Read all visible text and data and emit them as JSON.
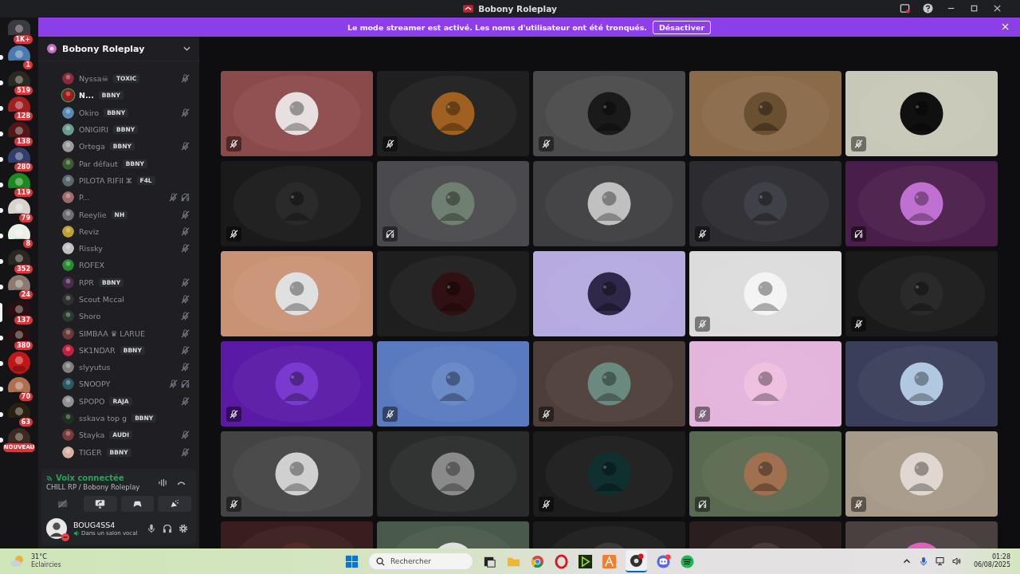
{
  "window": {
    "title": "Bobony Roleplay"
  },
  "banner": {
    "text": "Le mode streamer est activé. Les noms d'utilisateur ont été tronqués.",
    "button": "Désactiver"
  },
  "servers": [
    {
      "badge": "1K+",
      "selected": false,
      "unread": false
    },
    {
      "badge": "1",
      "selected": false,
      "unread": true
    },
    {
      "badge": "519",
      "selected": false,
      "unread": true
    },
    {
      "badge": "128",
      "selected": false,
      "unread": true
    },
    {
      "badge": "138",
      "selected": false,
      "unread": true
    },
    {
      "badge": "280",
      "selected": false,
      "unread": true
    },
    {
      "badge": "119",
      "selected": false,
      "unread": true
    },
    {
      "badge": "79",
      "selected": false,
      "unread": true
    },
    {
      "badge": "8",
      "selected": false,
      "unread": true
    },
    {
      "badge": "352",
      "selected": false,
      "unread": true
    },
    {
      "badge": "24",
      "selected": false,
      "unread": true
    },
    {
      "badge": "137",
      "selected": true,
      "unread": false
    },
    {
      "badge": "380",
      "selected": false,
      "unread": true
    },
    {
      "selected": false,
      "unread": true
    },
    {
      "badge": "70",
      "selected": false,
      "unread": true
    },
    {
      "badge": "63",
      "selected": false,
      "unread": true
    },
    {
      "badge": "NOUVEAU",
      "selected": false,
      "unread": true
    }
  ],
  "server_header": {
    "title": "Bobony Roleplay"
  },
  "members": [
    {
      "name": "Nyssa☠",
      "tag": "TOXIC",
      "muted": true,
      "deafened": false,
      "speaking": false
    },
    {
      "name": "N...",
      "tag": "BBNY",
      "muted": false,
      "deafened": false,
      "speaking": true
    },
    {
      "name": "Okiro",
      "tag": "BBNY",
      "muted": true,
      "deafened": false,
      "speaking": false
    },
    {
      "name": "ONIGIRI",
      "tag": "BBNY",
      "muted": false,
      "deafened": false,
      "speaking": false
    },
    {
      "name": "Ortega",
      "tag": "BBNY",
      "muted": true,
      "deafened": false,
      "speaking": false
    },
    {
      "name": "Par défaut",
      "tag": "BBNY",
      "muted": false,
      "deafened": false,
      "speaking": false
    },
    {
      "name": "PILOTA RIFII ⵣ",
      "tag": "F4L",
      "muted": false,
      "deafened": false,
      "speaking": false
    },
    {
      "name": "P...",
      "muted": true,
      "deafened": true,
      "speaking": false
    },
    {
      "name": "Reeylie",
      "tag": "NH",
      "muted": true,
      "deafened": false,
      "speaking": false
    },
    {
      "name": "Reviz",
      "muted": true,
      "deafened": false,
      "speaking": false
    },
    {
      "name": "Rissky",
      "muted": true,
      "deafened": false,
      "speaking": false
    },
    {
      "name": "ROFEX",
      "muted": false,
      "deafened": false,
      "speaking": false
    },
    {
      "name": "RPR",
      "tag": "BBNY",
      "muted": true,
      "deafened": false,
      "speaking": false
    },
    {
      "name": "Scout Mccal",
      "muted": true,
      "deafened": false,
      "speaking": false
    },
    {
      "name": "Shoro",
      "muted": true,
      "deafened": false,
      "speaking": false
    },
    {
      "name": "SIMBAA ♛ LARUE",
      "muted": true,
      "deafened": false,
      "speaking": false
    },
    {
      "name": "SK1NDAR",
      "tag": "BBNY",
      "muted": true,
      "deafened": false,
      "speaking": false
    },
    {
      "name": "slyyutus",
      "muted": true,
      "deafened": false,
      "speaking": false
    },
    {
      "name": "SNOOPY",
      "muted": true,
      "deafened": true,
      "speaking": false
    },
    {
      "name": "SPOPO",
      "tag": "RAJA",
      "muted": true,
      "deafened": false,
      "speaking": false
    },
    {
      "name": "sskava top g",
      "tag": "BBNY",
      "muted": false,
      "deafened": false,
      "speaking": false
    },
    {
      "name": "Stayka",
      "tag": "AUDI",
      "muted": true,
      "deafened": false,
      "speaking": false
    },
    {
      "name": "TIGER",
      "tag": "BBNY",
      "muted": true,
      "deafened": false,
      "speaking": false
    }
  ],
  "voice_panel": {
    "status": "Voix connectée",
    "channel": "CHILL RP / Bobony Roleplay"
  },
  "user": {
    "name": "BOUG4SS4",
    "status": "Dans un salon vocal"
  },
  "tiles": [
    {
      "kind": "picture",
      "muted": true,
      "deafened": false
    },
    {
      "kind": "picture",
      "muted": true,
      "deafened": false
    },
    {
      "kind": "picture",
      "muted": true,
      "deafened": false
    },
    {
      "kind": "picture",
      "muted": false,
      "deafened": false
    },
    {
      "kind": "picture",
      "muted": true,
      "deafened": false
    },
    {
      "kind": "picture",
      "muted": true,
      "deafened": false
    },
    {
      "kind": "picture",
      "muted": false,
      "deafened": true
    },
    {
      "kind": "picture",
      "muted": false,
      "deafened": false
    },
    {
      "kind": "picture",
      "muted": true,
      "deafened": false
    },
    {
      "kind": "picture",
      "muted": false,
      "deafened": true
    },
    {
      "kind": "picture",
      "muted": false,
      "deafened": false
    },
    {
      "kind": "picture",
      "muted": false,
      "deafened": false
    },
    {
      "kind": "picture",
      "muted": false,
      "deafened": false
    },
    {
      "kind": "picture",
      "muted": true,
      "deafened": false
    },
    {
      "kind": "picture",
      "muted": true,
      "deafened": false
    },
    {
      "kind": "picture",
      "muted": true,
      "deafened": false
    },
    {
      "kind": "picture",
      "muted": true,
      "deafened": false
    },
    {
      "kind": "picture",
      "muted": true,
      "deafened": false
    },
    {
      "kind": "picture",
      "muted": true,
      "deafened": false
    },
    {
      "kind": "picture",
      "muted": false,
      "deafened": false
    },
    {
      "kind": "picture",
      "muted": true,
      "deafened": false
    },
    {
      "kind": "picture",
      "muted": false,
      "deafened": false
    },
    {
      "kind": "picture",
      "muted": true,
      "deafened": false
    },
    {
      "kind": "picture",
      "muted": false,
      "deafened": true
    },
    {
      "kind": "picture",
      "muted": true,
      "deafened": false
    },
    {
      "kind": "picture",
      "muted": false,
      "deafened": false
    },
    {
      "kind": "picture",
      "muted": false,
      "deafened": false
    },
    {
      "kind": "picture",
      "muted": false,
      "deafened": false
    },
    {
      "kind": "picture",
      "muted": false,
      "deafened": false
    },
    {
      "kind": "picture",
      "muted": false,
      "deafened": false
    }
  ],
  "taskbar": {
    "temperature": "31°C",
    "weather": "Eclaircies",
    "search": {
      "placeholder": "Rechercher"
    },
    "time": "01:28",
    "date": "06/08/2025"
  }
}
